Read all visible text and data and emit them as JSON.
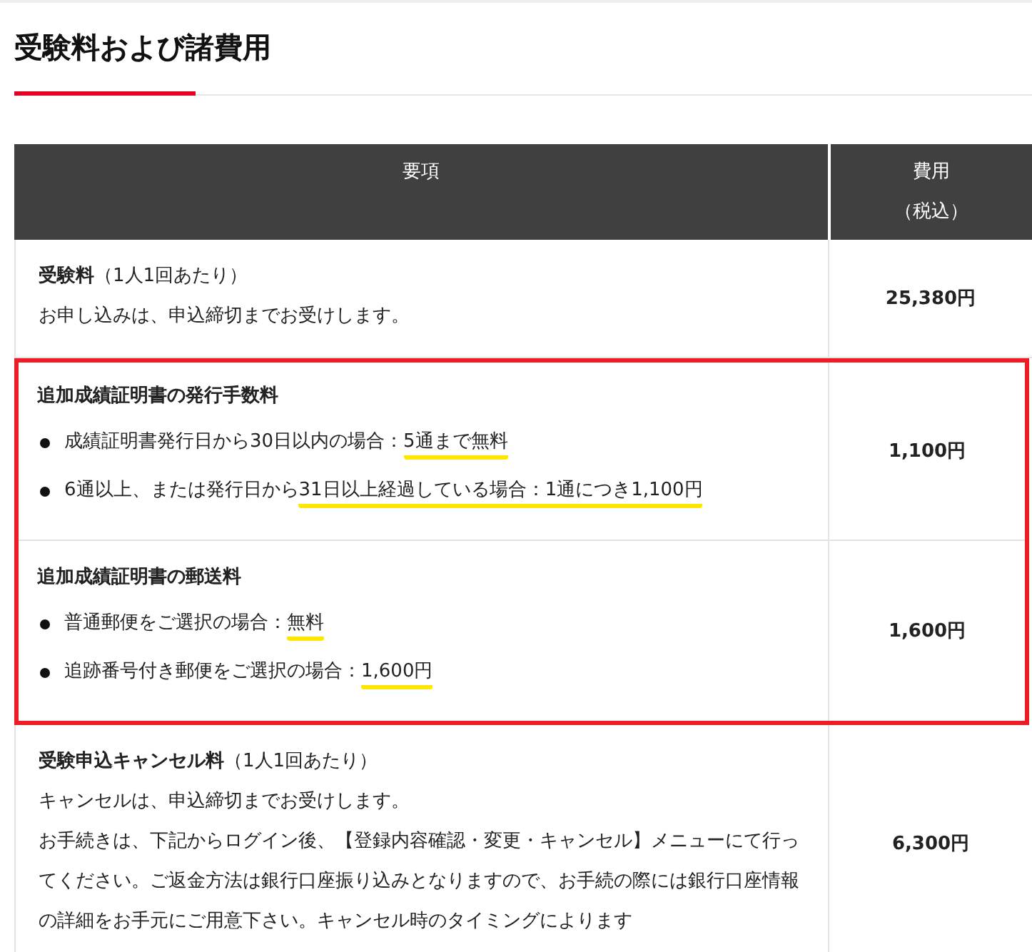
{
  "heading": {
    "title": "受験料および諸費用"
  },
  "table": {
    "columns": [
      {
        "lines": [
          "要項"
        ]
      },
      {
        "lines": [
          "費用",
          "（税込）"
        ]
      }
    ],
    "rows": [
      {
        "framed": false,
        "title": "**受験料**（1人1回あたり）",
        "kind": "text",
        "paragraphs": [
          "お申し込みは、申込締切までお受けします。"
        ],
        "fee": "25,380円"
      },
      {
        "framed": true,
        "title": "**追加成績証明書の発行手数料**",
        "kind": "bullets",
        "items": [
          [
            {
              "text": "成績証明書発行日から30日以内の場合：",
              "highlighted": false
            },
            {
              "text": "5通まで無料",
              "highlighted": true
            }
          ],
          [
            {
              "text": "6通以上、または発行日から",
              "highlighted": false
            },
            {
              "text": "31日以上経過している場合：1通につき1,100円",
              "highlighted": true
            }
          ]
        ],
        "fee": "1,100円"
      },
      {
        "framed": true,
        "title": "**追加成績証明書の郵送料**",
        "kind": "bullets",
        "items": [
          [
            {
              "text": "普通郵便をご選択の場合：",
              "highlighted": false
            },
            {
              "text": "無料",
              "highlighted": true
            }
          ],
          [
            {
              "text": "追跡番号付き郵便をご選択の場合：",
              "highlighted": false
            },
            {
              "text": "1,600円",
              "highlighted": true
            }
          ]
        ],
        "fee": "1,600円"
      },
      {
        "framed": false,
        "title": "**受験申込キャンセル料**（1人1回あたり）",
        "kind": "text",
        "paragraphs": [
          "キャンセルは、申込締切までお受けします。",
          "お手続きは、下記からログイン後、【登録内容確認・変更・キャンセル】メニューにて行ってください。ご返金方法は銀行口座振り込みとなりますので、お手続の際には銀行口座情報の詳細をお手元にご用意下さい。キャンセル時のタイミングによります"
        ],
        "fee": "6,300円"
      }
    ]
  }
}
